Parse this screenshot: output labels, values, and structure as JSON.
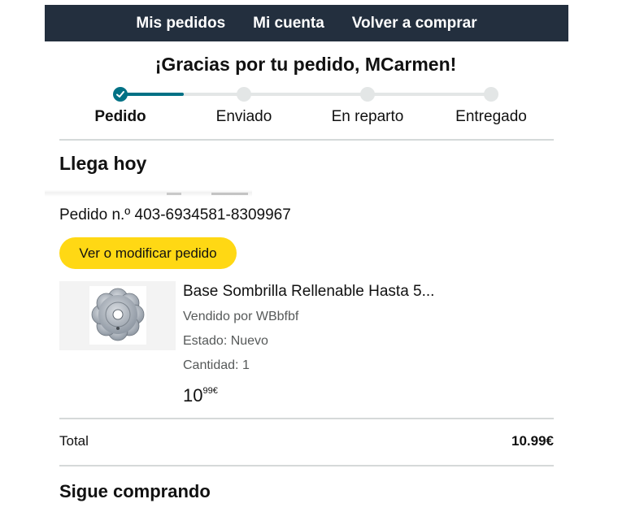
{
  "nav": {
    "my_orders": "Mis pedidos",
    "my_account": "Mi cuenta",
    "buy_again": "Volver a comprar"
  },
  "header": {
    "thanks": "¡Gracias por tu pedido, MCarmen!"
  },
  "tracker": {
    "steps": [
      "Pedido",
      "Enviado",
      "En reparto",
      "Entregado"
    ],
    "current_step": 0,
    "progress_fraction": 0.17,
    "colors": {
      "active": "#007185",
      "inactive": "#e3e6e6"
    }
  },
  "delivery": {
    "title": "Llega hoy",
    "order_number": "Pedido n.º 403-6934581-8309967",
    "modify_button": "Ver o modificar pedido"
  },
  "product": {
    "title": "Base Sombrilla Rellenable Hasta 5...",
    "seller": "Vendido por WBbfbf",
    "condition": "Estado: Nuevo",
    "quantity": "Cantidad: 1",
    "price_whole": "10",
    "price_fraction": "99€",
    "image_icon": "umbrella-base-icon"
  },
  "summary": {
    "total_label": "Total",
    "total_value": "10.99€"
  },
  "footer": {
    "keep_shopping": "Sigue comprando"
  },
  "colors": {
    "nav_bg": "#232f3e",
    "button_yellow": "#ffd814",
    "accent_teal": "#007185"
  }
}
